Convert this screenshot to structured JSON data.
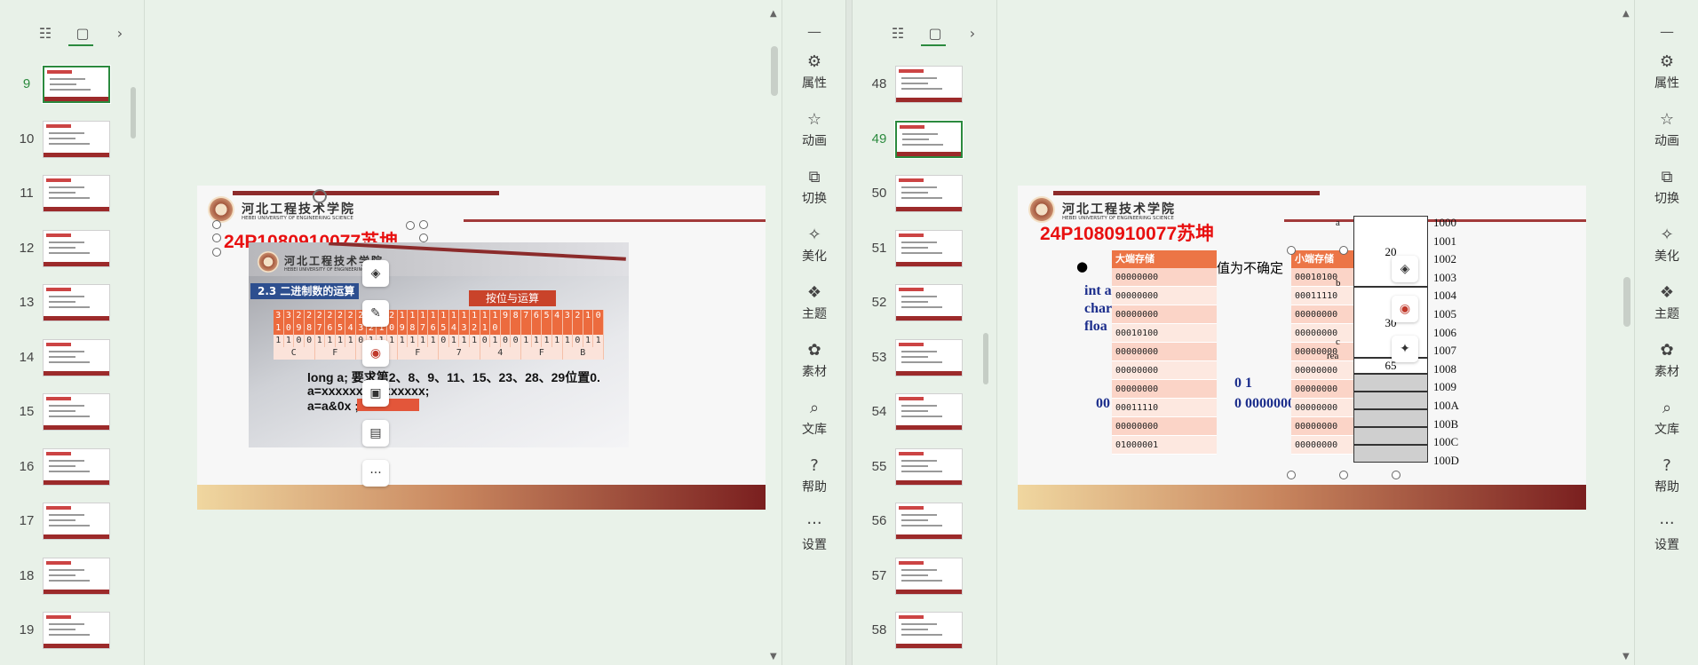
{
  "left_pane": {
    "slides": [
      {
        "num": "9",
        "active": true
      },
      {
        "num": "10"
      },
      {
        "num": "11"
      },
      {
        "num": "12"
      },
      {
        "num": "13"
      },
      {
        "num": "14"
      },
      {
        "num": "15"
      },
      {
        "num": "16"
      },
      {
        "num": "17"
      },
      {
        "num": "18"
      },
      {
        "num": "19"
      }
    ],
    "slide": {
      "university_cn": "河北工程技术学院",
      "university_en": "HEBEI UNIVERSITY OF ENGINEERING SCIENCE",
      "student_id": "24P1080910077苏坤",
      "photo": {
        "university_cn": "河北工程技术学院",
        "university_en": "HEBEI UNIVERSITY OF ENGINEERING SCIENCE",
        "section": "2.3  二进制数的运算",
        "op_title": "按位与运算",
        "bit_index_row1": [
          "3",
          "3",
          "2",
          "2",
          "2",
          "2",
          "2",
          "2",
          "2",
          "2",
          "2",
          "2",
          "1",
          "1",
          "1",
          "1",
          "1",
          "1",
          "1",
          "1",
          "1",
          "1",
          "9",
          "8",
          "7",
          "6",
          "5",
          "4",
          "3",
          "2",
          "1",
          "0"
        ],
        "bit_index_row2": [
          "1",
          "0",
          "9",
          "8",
          "7",
          "6",
          "5",
          "4",
          "3",
          "2",
          "1",
          "0",
          "9",
          "8",
          "7",
          "6",
          "5",
          "4",
          "3",
          "2",
          "1",
          "0",
          " ",
          " ",
          " ",
          " ",
          " ",
          " ",
          " ",
          " ",
          " ",
          " "
        ],
        "bit_values": [
          "1",
          "1",
          "0",
          "0",
          "1",
          "1",
          "1",
          "1",
          "0",
          "1",
          "1",
          "1",
          "1",
          "1",
          "1",
          "1",
          "0",
          "1",
          "1",
          "1",
          "0",
          "1",
          "0",
          "0",
          "1",
          "1",
          "1",
          "1",
          "1",
          "0",
          "1",
          "1"
        ],
        "hex_row": [
          "C",
          "F",
          "7",
          "F",
          "7",
          "4",
          "F",
          "B"
        ],
        "line1": "long  a;     要求第2、8、9、11、15、23、28、29位置0.",
        "line2": "a=xxxxxxxxxxxxxxx;",
        "line3": "a=a&0x                    ;"
      }
    }
  },
  "right_pane": {
    "slides": [
      {
        "num": "48"
      },
      {
        "num": "49",
        "active": true
      },
      {
        "num": "50"
      },
      {
        "num": "51"
      },
      {
        "num": "52"
      },
      {
        "num": "53"
      },
      {
        "num": "54"
      },
      {
        "num": "55"
      },
      {
        "num": "56"
      },
      {
        "num": "57"
      },
      {
        "num": "58"
      }
    ],
    "slide": {
      "university_cn": "河北工程技术学院",
      "university_en": "HEBEI UNIVERSITY OF ENGINEERING SCIENCE",
      "student_id": "24P1080910077苏坤",
      "bullet_text": "值为不确定",
      "code_lines": [
        "int a",
        "char",
        "floa"
      ],
      "partial_num": "0 1",
      "partial_bits_left": "00",
      "partial_bits_right": "0 00000000",
      "big_endian": {
        "header": "大端存储",
        "rows": [
          "00000000",
          "00000000",
          "00000000",
          "00010100",
          "00000000",
          "00000000",
          "00000000",
          "00011110",
          "00000000",
          "01000001"
        ]
      },
      "little_endian": {
        "header": "小端存储",
        "rows": [
          "00010100",
          "00011110",
          "00000000",
          "00000000",
          "00000000",
          "00000000",
          "00000000",
          "00000000",
          "00000000",
          "00000000"
        ]
      },
      "memory": {
        "var_a": "a",
        "var_b": "b",
        "var_c": "c",
        "var_area": "rea",
        "val_a": "20",
        "val_b": "30",
        "val_c": "65",
        "addresses": [
          "1000",
          "1001",
          "1002",
          "1003",
          "1004",
          "1005",
          "1006",
          "1007",
          "1008",
          "1009",
          "100A",
          "100B",
          "100C",
          "100D"
        ]
      }
    }
  },
  "right_panel": {
    "items": [
      {
        "icon": "properties-icon",
        "label": "属性"
      },
      {
        "icon": "animation-icon",
        "label": "动画"
      },
      {
        "icon": "transition-icon",
        "label": "切换"
      },
      {
        "icon": "beautify-icon",
        "label": "美化"
      },
      {
        "icon": "theme-icon",
        "label": "主题"
      },
      {
        "icon": "material-icon",
        "label": "素材"
      },
      {
        "icon": "library-icon",
        "label": "文库"
      },
      {
        "icon": "help-icon",
        "label": "帮助"
      },
      {
        "icon": "settings-icon",
        "label": "设置"
      }
    ]
  },
  "float_tools": {
    "more_label": "···"
  }
}
